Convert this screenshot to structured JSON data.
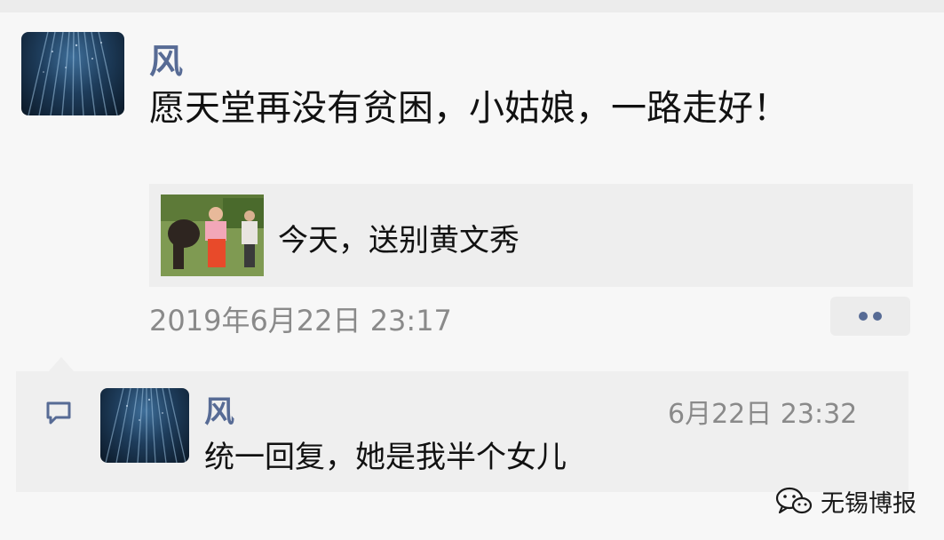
{
  "post": {
    "nickname": "风",
    "text": "愿天堂再没有贫困，小姑娘，一路走好！",
    "link_card": {
      "title": "今天，送别黄文秀"
    },
    "timestamp": "2019年6月22日 23:17"
  },
  "comment": {
    "nickname": "风",
    "timestamp": "6月22日 23:32",
    "text": "统一回复，她是我半个女儿"
  },
  "watermark": {
    "text": "无锡博报"
  },
  "colors": {
    "nickname": "#576b95",
    "page_background": "#f7f7f7",
    "comment_background": "#efefef",
    "link_card_background": "#eeeeee",
    "timestamp": "#8a8a8a"
  },
  "icons": {
    "comment": "speech-bubble-icon",
    "more": "two-dots-icon",
    "watermark": "wechat-icon"
  }
}
